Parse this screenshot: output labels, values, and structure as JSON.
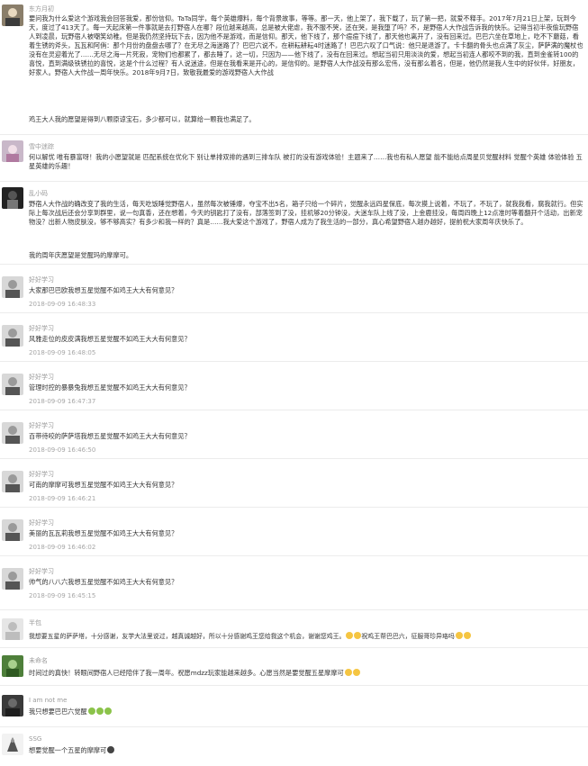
{
  "comments": [
    {
      "user": "东方月初",
      "text": "要问我为什么爱这个游戏我会回答我爱，那份信仰。TaTa同学，每个英雄爆料，每个背景故事，等等。那一天，他上架了，我下载了，玩了第一把，就爱不释手。2017年7月21日上架，玩到今天，度过了413天了。每一天起床第一件事就是去打野宿人在哪？段位越来越高，总是被大佬虐，我不服不哭，还在哭，是我堕了吗？不，是野宿人大作战告诉我的快乐。记得当初半夜偷玩野宿人到凌晨，玩野宿人被嘲笑幼稚。但是我仍然坚持玩下去，因为他不是游戏，而是信仰。那天，他下线了，那个痘痘下线了，那天他也离开了，没有回来过。巴巴六坐在草地上，吃不下蘑菇，看着生锈的斧头，瓦瓦和阿俏：那个月份的盘盘去哪了？在无尽之海迷路了？巴巴六说不，在耕耘耕耘4时迷路了！巴巴六叹了口气说：他只是退游了。卡卡翻的骨头也点满了灰尘，萨萨满的魔杖也没有在灵迎着光了……无尽之海一片死寂，宠物们也都累了，都去睡了，这一切，只因为——他下线了，没有在回来过。想起当初只用淡淡的爱，想起当初连人都咬不到的我，直到金雀转100的喜悦，直到满级铁锈拉的喜悦，这是个什么过程？有人说迷途，但是在我看来是开心的，是信仰的。是野宿人大作战没有那么宏伟，没有那么着名，但是，他仍然是我人生中的好伙伴，好朋友，好家人。野宿人大作战一周年快乐。2018年9月7日，致敬我最爱的游戏野宿人大作战",
      "text2": "鸡王大人我的愿望是得到八颗原谅宝石，多少都可以，就算给一颗我也满足了。"
    },
    {
      "user": "雪中迷踪",
      "text": "何以解忧 唯有暴富呀！我的小愿望就是 匹配系统在优化下 别让单排双排的遇到三排车队 被打的没有游戏体验！主题来了……我也有私人愿望 能不能给点周星贝觉醒材料 觉醒个英雄 体验体验 五星英雄的乐趣！"
    },
    {
      "user": "乱小码",
      "text": "野宿人大作战的确改变了我的生活，每天吃饭睡觉野宿人，虽然每次被锤爆，夺宝不出5名，箱子只给一个碎片，觉醒永远四星保底，每次摸上说着，不玩了，不玩了，就我我看，腐我就行。但实际上每次战后还会分享到群里，说一句真香，还在想着，今天的钥匙打了没有，部落签到了没，挂机够20分钟没，大迷车队上线了没，上金鹿挂没，每周四晚上12点准时等着翻开个活动，出新宠物没？出新人物皮肤没，够不够高实？有多少和我一样的？真是……我大爱这个游戏了，野宿人成为了我生活的一部分，真心希望野宿人越办越好，提前祝大家周年庆快乐了。",
      "text2": "我的周年庆愿望是觉醒玛的摩摩可。"
    },
    {
      "user": "好好学习",
      "text": "大家那巴巴欧我想五星觉醒不如鸡王大大有何意见？",
      "time": "2018-09-09 16:48:33"
    },
    {
      "user": "好好学习",
      "text": "风雅走位的皮皮满我想五星觉醒不如鸡王大大有何意见？",
      "time": "2018-09-09 16:48:05"
    },
    {
      "user": "好好学习",
      "text": "管理时控的暴暴兔我想五星觉醒不如鸡王大大有何意见？",
      "time": "2018-09-09 16:47:37"
    },
    {
      "user": "好好学习",
      "text": "百带待咬的萨萨塔我想五星觉醒不如鸡王大大有何意见？",
      "time": "2018-09-09 16:46:50"
    },
    {
      "user": "好好学习",
      "text": "可南的摩摩可我想五星觉醒不如鸡王大大有何意见？",
      "time": "2018-09-09 16:46:21"
    },
    {
      "user": "好好学习",
      "text": "美丽的瓦瓦莉我想五星觉醒不如鸡王大大有何意见？",
      "time": "2018-09-09 16:46:02"
    },
    {
      "user": "好好学习",
      "text": "帅气的八八六我想五星觉醒不如鸡王大大有何意见？",
      "time": "2018-09-09 16:45:15"
    },
    {
      "user": "半包",
      "text": "我想要五星的萨萨塔，十分感谢，友学大法里说过，越真诚越好，所以十分感谢鸡王您给我这个机会，谢谢您鸡王。",
      "text2": "祝鸡王帮巴巴六，征服哥珍异珞吗"
    },
    {
      "user": "未命名",
      "text": "时间过的真快！转眼间野宿人已经陪伴了我一周年。祝愿mdzz玩家能越来越多。心愿当然是要觉醒五星摩摩可"
    },
    {
      "user": "I am not me",
      "text": "我只想要巴巴六觉醒"
    },
    {
      "user": "SSG",
      "text": "想要觉醒一个五星的摩摩可"
    }
  ]
}
